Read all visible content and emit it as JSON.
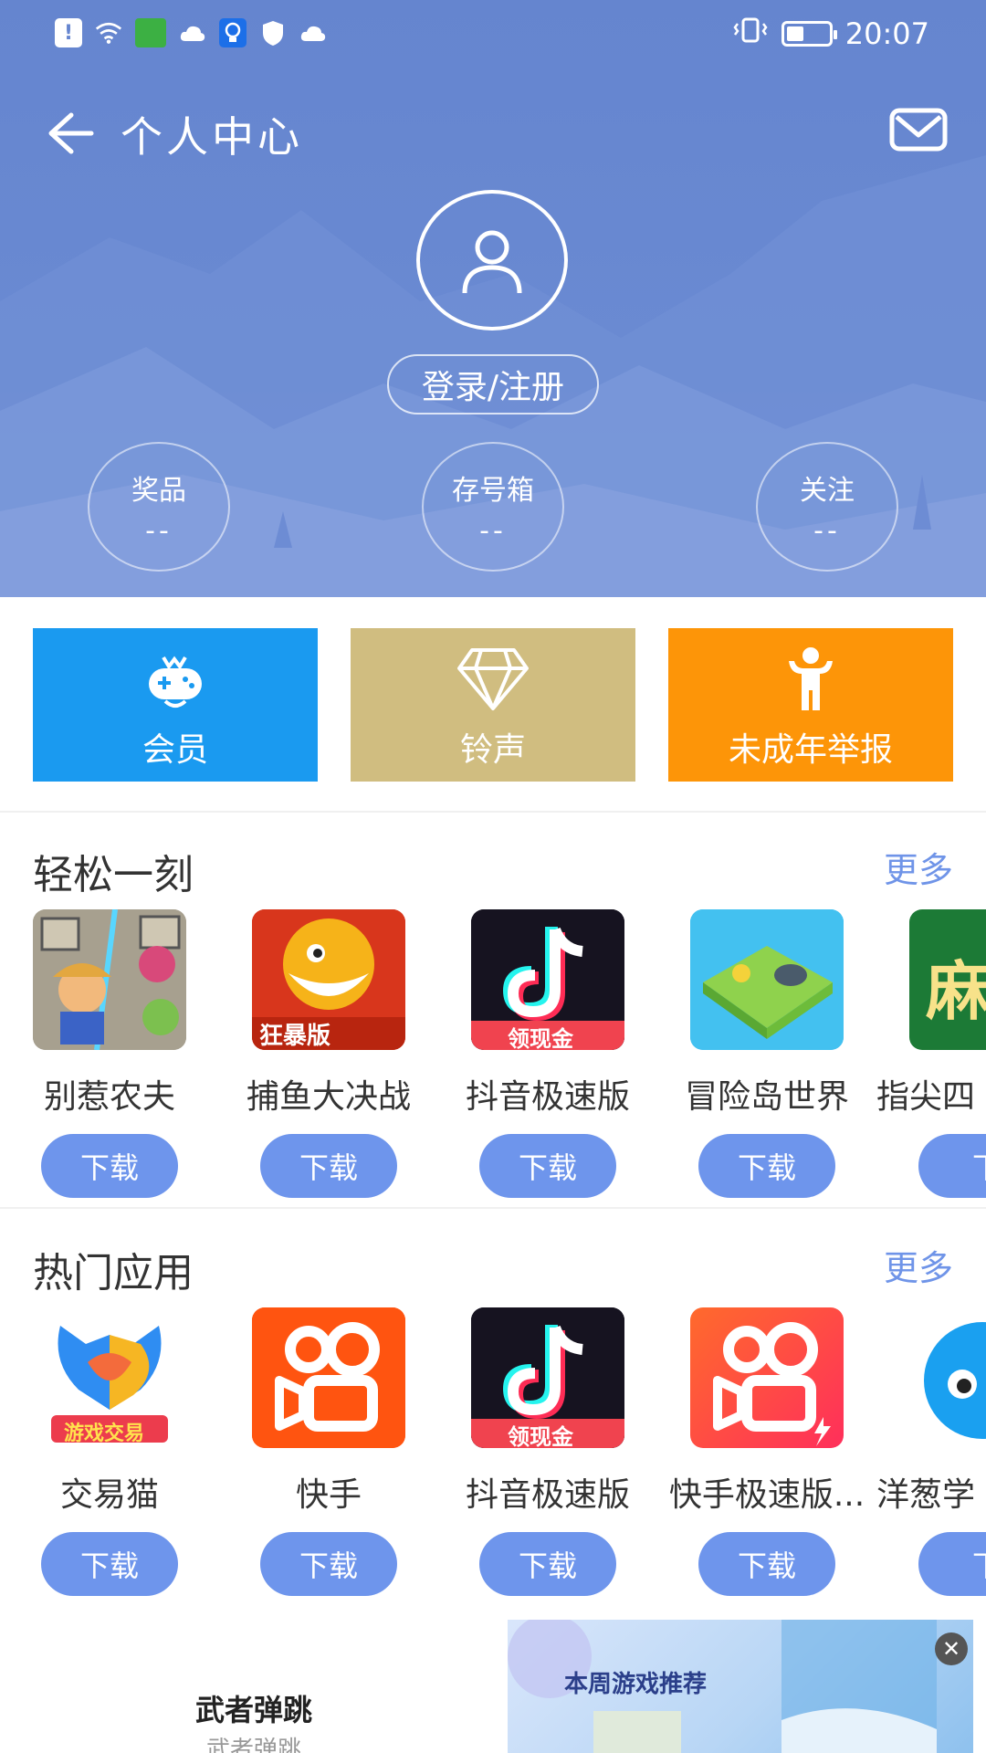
{
  "status_bar": {
    "time": "20:07"
  },
  "header": {
    "title": "个人中心",
    "login_label": "登录/注册"
  },
  "stats": [
    {
      "label": "奖品",
      "value": "--"
    },
    {
      "label": "存号箱",
      "value": "--"
    },
    {
      "label": "关注",
      "value": "--"
    }
  ],
  "tiles": [
    {
      "label": "会员",
      "color": "#1a9af0"
    },
    {
      "label": "铃声",
      "color": "#d0bd80"
    },
    {
      "label": "未成年举报",
      "color": "#fd9508"
    }
  ],
  "section1": {
    "title": "轻松一刻",
    "more": "更多",
    "apps": [
      {
        "name": "别惹农夫",
        "button": "下载"
      },
      {
        "name": "捕鱼大决战",
        "button": "下载"
      },
      {
        "name": "抖音极速版",
        "button": "下载"
      },
      {
        "name": "冒险岛世界",
        "button": "下载"
      },
      {
        "name": "指尖四",
        "button": "下"
      }
    ]
  },
  "section2": {
    "title": "热门应用",
    "more": "更多",
    "apps": [
      {
        "name": "交易猫",
        "button": "下载"
      },
      {
        "name": "快手",
        "button": "下载"
      },
      {
        "name": "抖音极速版",
        "button": "下载"
      },
      {
        "name": "快手极速版...",
        "button": "下载"
      },
      {
        "name": "洋葱学",
        "button": "下"
      }
    ]
  },
  "icon_texts": {
    "fish_badge": "狂暴版",
    "douyin_badge": "领现金",
    "jiaoyimao_badge": "游戏交易",
    "majiang": "麻"
  },
  "ad": {
    "title": "武者弹跳",
    "subtitle": "武者弹跳",
    "banner_text": "本周游戏推荐"
  }
}
